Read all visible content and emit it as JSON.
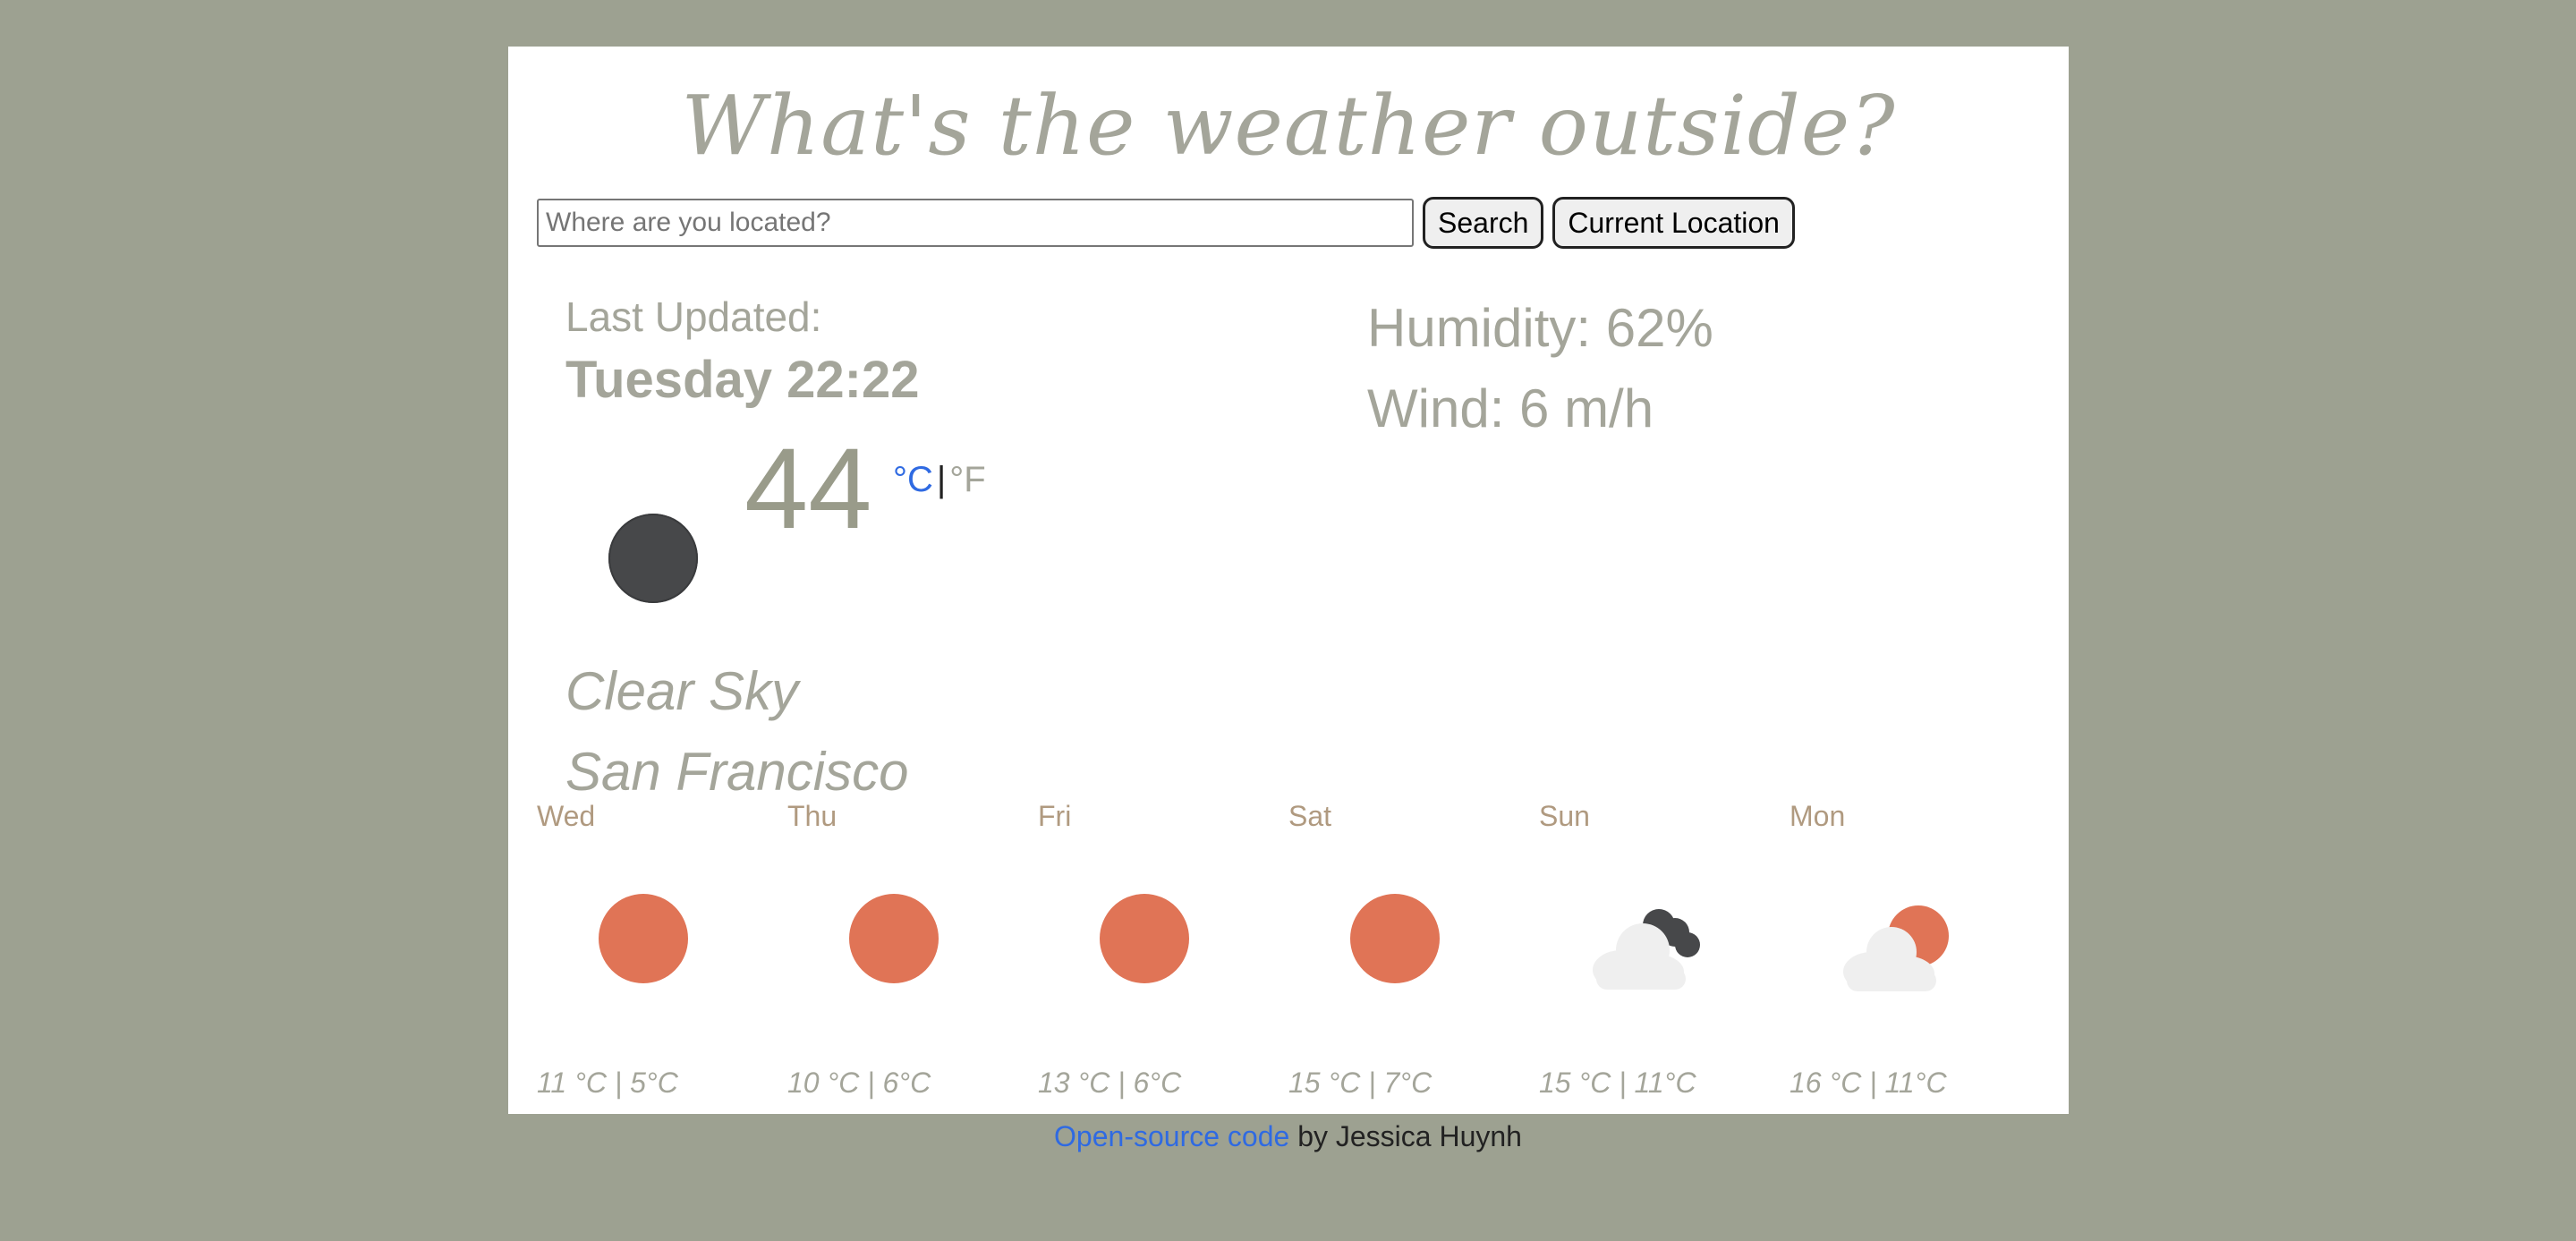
{
  "header": {
    "title": "What's the weather outside?"
  },
  "search": {
    "placeholder": "Where are you located?",
    "value": "",
    "search_label": "Search",
    "current_location_label": "Current Location"
  },
  "current": {
    "last_updated_label": "Last Updated:",
    "last_updated_time": "Tuesday 22:22",
    "icon": "moon-icon",
    "temperature": "44",
    "unit_celsius": "°C",
    "unit_separator": "|",
    "unit_fahrenheit": "°F",
    "description": "Clear Sky",
    "city": "San Francisco",
    "humidity": "Humidity: 62%",
    "wind": "Wind: 6 m/h"
  },
  "forecast": [
    {
      "day": "Wed",
      "icon": "sun-icon",
      "temps": "11 °C | 5°C"
    },
    {
      "day": "Thu",
      "icon": "sun-icon",
      "temps": "10 °C | 6°C"
    },
    {
      "day": "Fri",
      "icon": "sun-icon",
      "temps": "13 °C | 6°C"
    },
    {
      "day": "Sat",
      "icon": "sun-icon",
      "temps": "15 °C | 7°C"
    },
    {
      "day": "Sun",
      "icon": "cloud-night-icon",
      "temps": "15 °C | 11°C"
    },
    {
      "day": "Mon",
      "icon": "cloud-sun-icon",
      "temps": "16 °C | 11°C"
    }
  ],
  "footer": {
    "link_text": "Open-source code",
    "suffix": " by Jessica Huynh"
  },
  "colors": {
    "background": "#9da191",
    "accent_link": "#2f6ae2",
    "sun": "#e07456",
    "moon": "#47484a",
    "cloud": "#efefef",
    "day_name": "#b09a80",
    "muted_text": "#a4a59a"
  }
}
